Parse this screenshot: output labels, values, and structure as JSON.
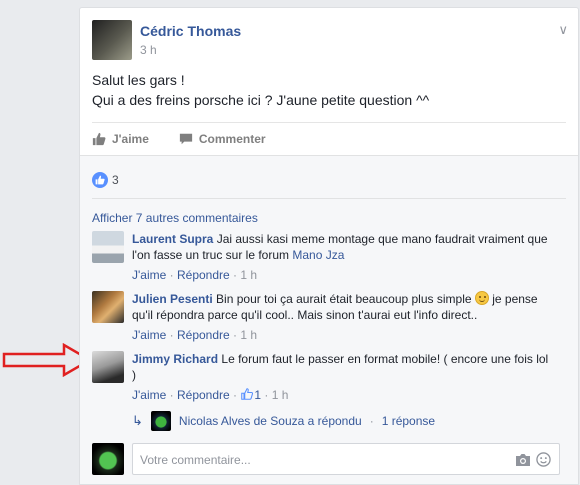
{
  "post": {
    "author": "Cédric Thomas",
    "time": "3 h",
    "text_line1": "Salut les gars !",
    "text_line2": "Qui a des freins porsche ici ? J'aune petite question ^^"
  },
  "actions": {
    "like_label": "J'aime",
    "comment_label": "Commenter"
  },
  "reactions": {
    "count": "3"
  },
  "comments_section": {
    "more_label": "Afficher 7 autres commentaires",
    "comments": [
      {
        "name": "Laurent Supra",
        "text": "Jai aussi kasi meme montage que mano faudrait vraiment que l'on fasse un truc sur le forum",
        "link": "Mano Jza",
        "like": "J'aime",
        "reply": "Répondre",
        "time": "1 h"
      },
      {
        "name": "Julien Pesenti",
        "text_before": "Bin pour toi ça aurait était beaucoup plus simple",
        "text_after": "je pense qu'il répondra parce qu'il cool.. Mais sinon t'aurai eut l'info direct..",
        "like": "J'aime",
        "reply": "Répondre",
        "time": "1 h"
      },
      {
        "name": "Jimmy Richard",
        "text": "Le forum faut le passer en format mobile! ( encore une fois lol )",
        "like": "J'aime",
        "reply": "Répondre",
        "likes_count": "1",
        "time": "1 h"
      }
    ],
    "reply_summary": {
      "text": "Nicolas Alves de Souza a répondu",
      "count": "1 réponse"
    }
  },
  "composer": {
    "placeholder": "Votre commentaire..."
  },
  "colors": {
    "link": "#365899",
    "annotation_arrow": "#e02020",
    "like_blue": "#5890ff"
  }
}
